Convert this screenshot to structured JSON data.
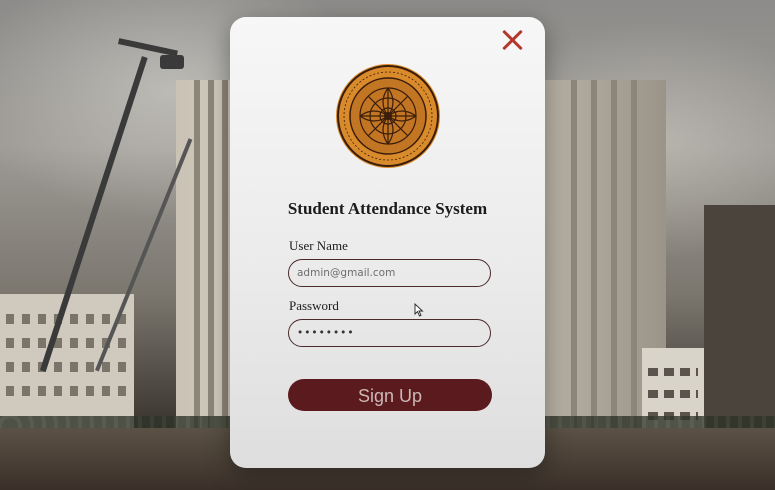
{
  "app": {
    "title": "Student Attendance System"
  },
  "form": {
    "username_label": "User Name",
    "username_value": "admin@gmail.com",
    "password_label": "Password",
    "password_value": "••••••••",
    "signup_label": "Sign Up"
  },
  "icons": {
    "close": "close-icon",
    "logo": "university-seal-icon"
  },
  "colors": {
    "accent": "#5a1a1e",
    "close": "#b23a2c",
    "card": "#eeeeee",
    "seal": "#d98a2b"
  }
}
